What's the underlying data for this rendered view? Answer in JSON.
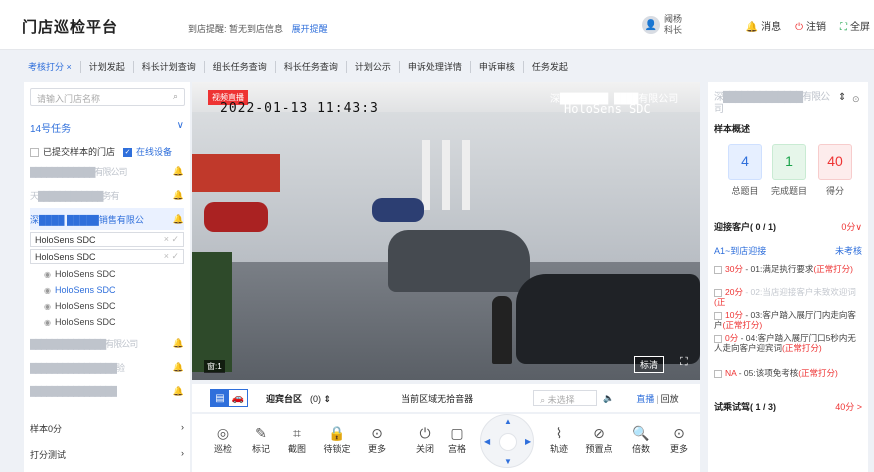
{
  "app": {
    "title": "门店巡检平台",
    "notice_label": "到店提醒:",
    "notice_text": "暂无到店信息",
    "notice_link": "展开提醒",
    "user_name": "阈杨科长",
    "message_label": "消息",
    "logout_label": "注销",
    "fullscreen_label": "全屏"
  },
  "tabs": [
    {
      "label": "考核打分 ×"
    },
    {
      "label": "计划发起"
    },
    {
      "label": "科长计划查询"
    },
    {
      "label": "组长任务查询"
    },
    {
      "label": "科长任务查询"
    },
    {
      "label": "计划公示"
    },
    {
      "label": "申诉处理详情"
    },
    {
      "label": "申诉审核"
    },
    {
      "label": "任务发起"
    }
  ],
  "left": {
    "search_placeholder": "请输入门店名称",
    "task_label": "14号任务",
    "chk_submitted": "已提交样本的门店",
    "chk_online": "在线设备",
    "stores": [
      {
        "name": "可限公司",
        "masked": "████████████有限公司"
      },
      {
        "name": "有限",
        "masked": "天████████████务有"
      },
      {
        "name": "销售有限公",
        "masked": "深████ █████销售有限公"
      }
    ],
    "dev1": "HoloSens SDC",
    "dev2": "HoloSens SDC",
    "cams": [
      "HoloSens SDC",
      "HoloSens SDC",
      "HoloSens SDC",
      "HoloSens SDC"
    ],
    "stores2": [
      {
        "masked": "██████████████有限公司"
      },
      {
        "masked": "████████████████验"
      },
      {
        "masked": "████████████████"
      }
    ],
    "sample_label": "样本0分",
    "score_test_label": "打分测试"
  },
  "video": {
    "live_badge": "视频直播",
    "timestamp": "2022-01-13 11:43:3",
    "osd_company": "深████████ ████有限公司",
    "osd_device": "HoloSens SDC",
    "win_index": "窗:1",
    "hd_label": "标清"
  },
  "controls": {
    "area_label": "迎宾台区",
    "area_count": "(0)",
    "speaker_text": "当前区域无拾音器",
    "select_placeholder": "未选择",
    "live_label": "直播",
    "playback_label": "回放"
  },
  "tools": [
    {
      "label": "巡检",
      "icon": "patrol-icon",
      "glyph": "◎"
    },
    {
      "label": "标记",
      "icon": "mark-icon",
      "glyph": "✎"
    },
    {
      "label": "截图",
      "icon": "crop-icon",
      "glyph": "⌗"
    },
    {
      "label": "待锁定",
      "icon": "lock-icon",
      "glyph": "🔒"
    },
    {
      "label": "更多",
      "icon": "more-icon",
      "glyph": "⊙"
    },
    {
      "label": "关闭",
      "icon": "power-icon",
      "glyph": "⏻"
    },
    {
      "label": "宫格",
      "icon": "grid-icon",
      "glyph": "▢"
    },
    {
      "label": "轨迹",
      "icon": "track-icon",
      "glyph": "⌇"
    },
    {
      "label": "预置点",
      "icon": "preset-icon",
      "glyph": "⊘"
    },
    {
      "label": "倍数",
      "icon": "zoom-icon",
      "glyph": "🔍"
    },
    {
      "label": "更多",
      "icon": "more-icon",
      "glyph": "⊙"
    }
  ],
  "right": {
    "store_masked": "深█████████████有限公司",
    "overview_label": "样本概述",
    "stats": [
      {
        "value": "4",
        "label": "总题目"
      },
      {
        "value": "1",
        "label": "完成题目"
      },
      {
        "value": "40",
        "label": "得分"
      }
    ],
    "section1": {
      "title": "迎接客户( 0 / 1)",
      "score": "0分∨"
    },
    "sub": {
      "title": "A1~到店迎接",
      "status": "未考核"
    },
    "items": [
      {
        "pts": "30分",
        "text": " - 01:满足执行要求",
        "tag": "(正常打分)"
      },
      {
        "pts": "20分",
        "text": " - 02:当店迎接客户未致欢迎词",
        "tag": "(正"
      },
      {
        "pts": "10分",
        "text": " - 03:客户踏入展厅门内走向客户",
        "tag": "(正常打分)"
      },
      {
        "pts": "0分",
        "text": " - 04:客户踏入展厅门口5秒内无人走向客户迎宾词",
        "tag": "(正常打分)"
      },
      {
        "pts": "NA",
        "text": " - 05:该项免考核",
        "tag": "(正常打分)"
      }
    ],
    "section2": {
      "title": "试乘试驾( 1 / 3)",
      "score": "40分 >"
    }
  }
}
